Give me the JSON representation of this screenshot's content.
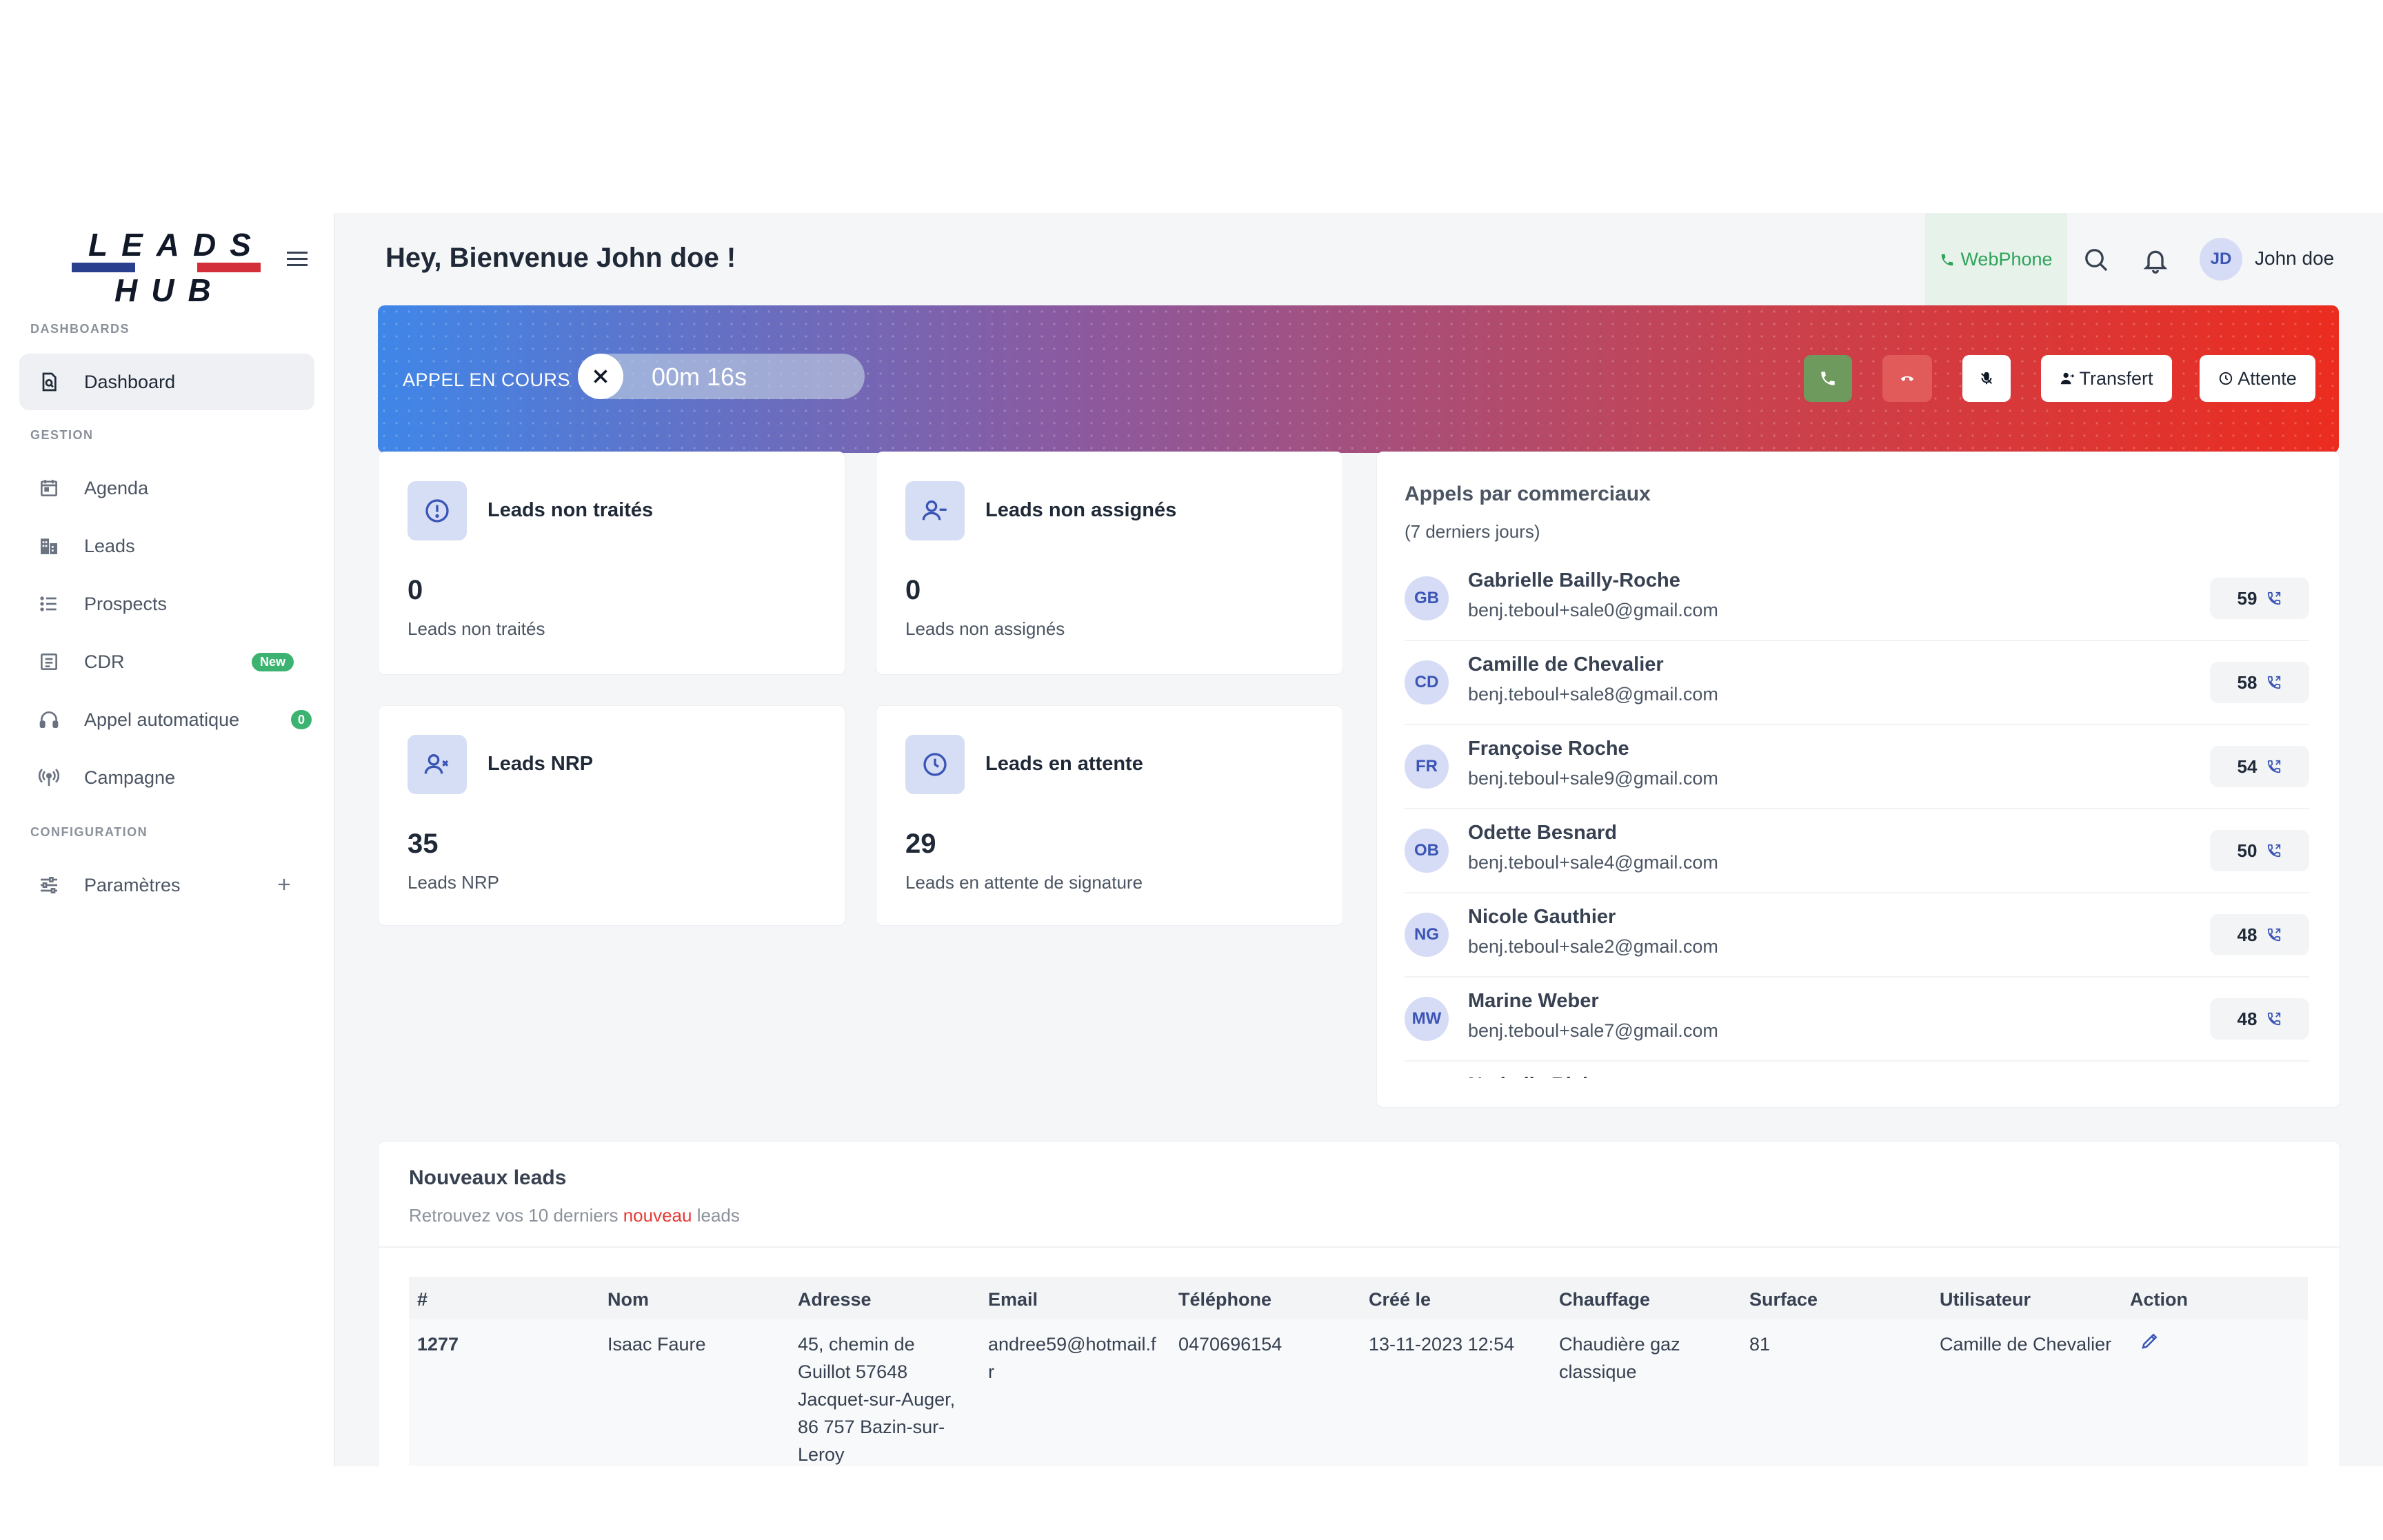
{
  "sidebar": {
    "logo_text_top": "LEADS",
    "logo_text_bottom": "HUB",
    "sections": {
      "dashboards": "DASHBOARDS",
      "gestion": "GESTION",
      "configuration": "CONFIGURATION"
    },
    "items": {
      "dashboard": "Dashboard",
      "agenda": "Agenda",
      "leads": "Leads",
      "prospects": "Prospects",
      "cdr": "CDR",
      "cdr_badge": "New",
      "appel_auto": "Appel automatique",
      "appel_auto_badge": "0",
      "campagne": "Campagne",
      "parametres": "Paramètres"
    }
  },
  "header": {
    "greeting": "Hey, Bienvenue John doe !",
    "webphone_label": "WebPhone",
    "user_initials": "JD",
    "user_name": "John doe"
  },
  "call_banner": {
    "label": "APPEL EN COURS",
    "timer": "00m 16s",
    "transfer_label": "Transfert",
    "hold_label": "Attente"
  },
  "stats": {
    "non_traites": {
      "title": "Leads non traités",
      "value": "0",
      "sub": "Leads non traités"
    },
    "non_assignes": {
      "title": "Leads non assignés",
      "value": "0",
      "sub": "Leads non assignés"
    },
    "nrp": {
      "title": "Leads NRP",
      "value": "35",
      "sub": "Leads NRP"
    },
    "attente": {
      "title": "Leads en attente",
      "value": "29",
      "sub": "Leads en attente de signature"
    }
  },
  "calls": {
    "title": "Appels par commerciaux",
    "subtitle": "(7 derniers jours)",
    "rows": [
      {
        "initials": "GB",
        "name": "Gabrielle Bailly-Roche",
        "email": "benj.teboul+sale0@gmail.com",
        "count": "59"
      },
      {
        "initials": "CD",
        "name": "Camille de Chevalier",
        "email": "benj.teboul+sale8@gmail.com",
        "count": "58"
      },
      {
        "initials": "FR",
        "name": "Françoise Roche",
        "email": "benj.teboul+sale9@gmail.com",
        "count": "54"
      },
      {
        "initials": "OB",
        "name": "Odette Besnard",
        "email": "benj.teboul+sale4@gmail.com",
        "count": "50"
      },
      {
        "initials": "NG",
        "name": "Nicole Gauthier",
        "email": "benj.teboul+sale2@gmail.com",
        "count": "48"
      },
      {
        "initials": "MW",
        "name": "Marine Weber",
        "email": "benj.teboul+sale7@gmail.com",
        "count": "48"
      },
      {
        "initials": "",
        "name": "Nathalie Riviere",
        "email": "",
        "count": ""
      }
    ]
  },
  "leads_table": {
    "title": "Nouveaux leads",
    "subtitle_pre": "Retrouvez vos 10 derniers",
    "subtitle_hl": "nouveau",
    "subtitle_post": "leads",
    "headers": {
      "id": "#",
      "nom": "Nom",
      "adresse": "Adresse",
      "email": "Email",
      "telephone": "Téléphone",
      "cree": "Créé le",
      "chauffage": "Chauffage",
      "surface": "Surface",
      "utilisateur": "Utilisateur",
      "action": "Action"
    },
    "rows": [
      {
        "id": "1277",
        "nom": "Isaac Faure",
        "adresse": "45, chemin de Guillot 57648 Jacquet-sur-Auger, 86 757 Bazin-sur-Leroy",
        "email": "andree59@hotmail.fr",
        "telephone": "0470696154",
        "cree": "13-11-2023 12:54",
        "chauffage": "Chaudière gaz classique",
        "surface": "81",
        "utilisateur": "Camille de Chevalier"
      }
    ]
  },
  "colors": {
    "accent": "#3a55b5",
    "success": "#3cb371",
    "danger": "#e53935",
    "banner_start": "#3f86e8",
    "banner_end": "#ec2c1f"
  }
}
